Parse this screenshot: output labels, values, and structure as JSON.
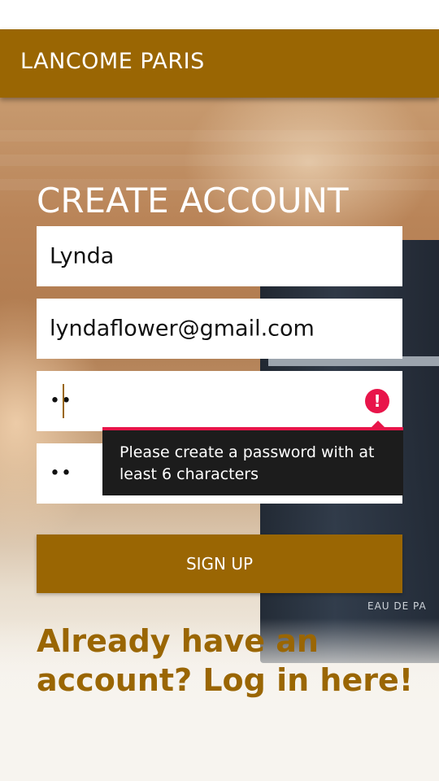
{
  "app_bar": {
    "title": "LANCOME PARIS"
  },
  "form": {
    "heading": "CREATE ACCOUNT",
    "name_value": "Lynda",
    "email_value": "lyndaflower@gmail.com",
    "password_value": "••",
    "confirm_password_value": "••",
    "password_error": "Please create a password with at least 6 characters",
    "signup_label": "SIGN UP",
    "login_link": "Already have an account? Log in here!"
  },
  "background": {
    "bottle_label": "EAU DE PA"
  },
  "colors": {
    "brand": "#9a6603",
    "error": "#e8154a",
    "tooltip_bg": "#1c1c1c"
  }
}
